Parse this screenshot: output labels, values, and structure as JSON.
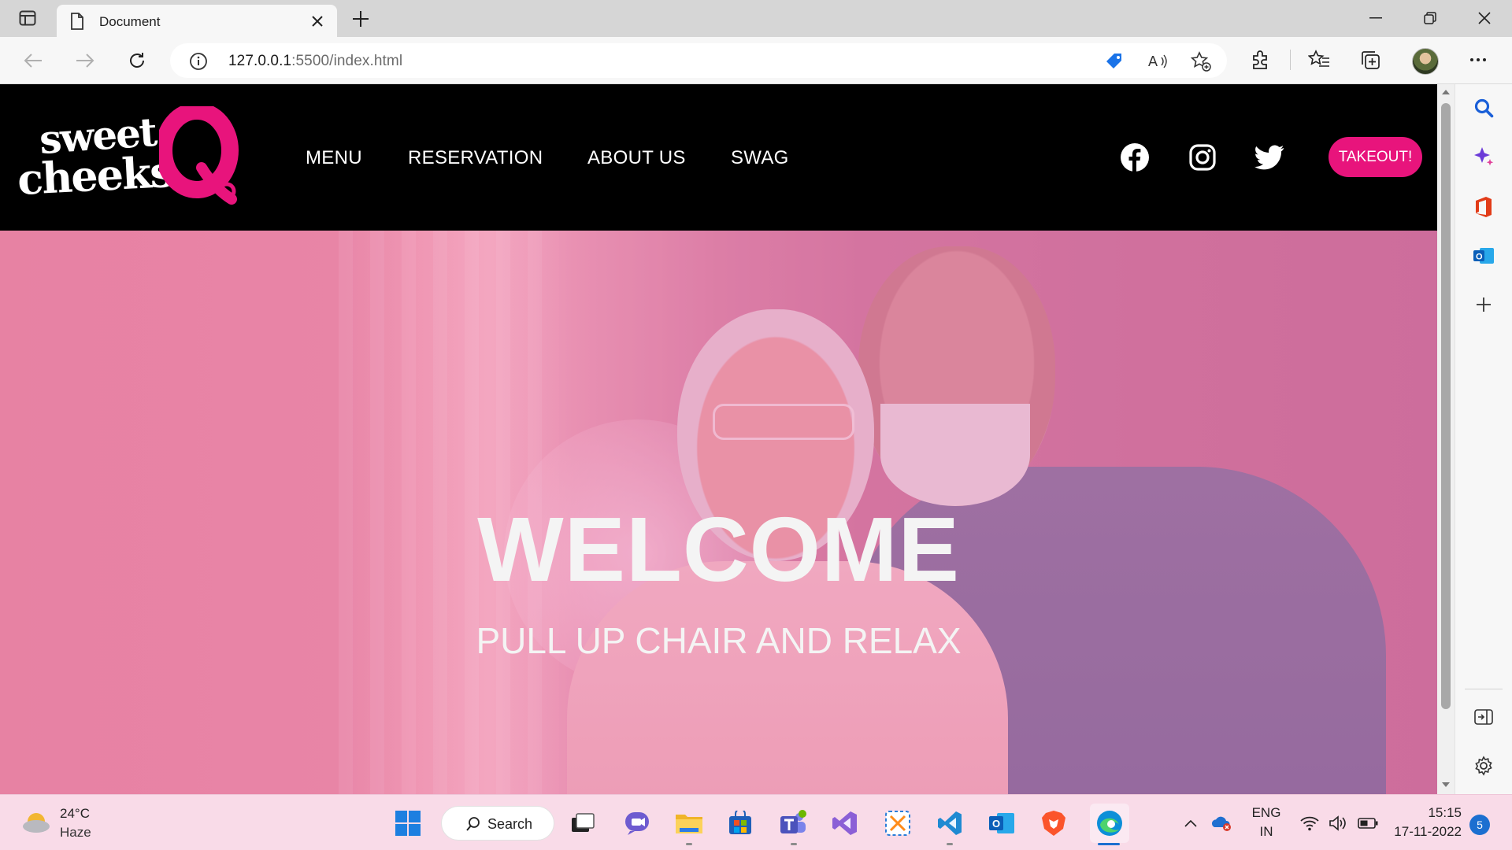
{
  "browser": {
    "tab_title": "Document",
    "url_host": "127.0.0.1",
    "url_rest": ":5500/index.html"
  },
  "site": {
    "logo_line1": "sweet",
    "logo_line2": "cheeks",
    "nav": [
      "MENU",
      "RESERVATION",
      "ABOUT US",
      "SWAG"
    ],
    "social_icons": [
      "facebook-icon",
      "instagram-icon",
      "twitter-icon"
    ],
    "takeout_label": "TAKEOUT!",
    "hero_title": "WELCOME",
    "hero_subtitle": "PULL UP CHAIR AND RELAX",
    "accent_color": "#e8147c"
  },
  "taskbar": {
    "weather_temp": "24°C",
    "weather_condition": "Haze",
    "search_label": "Search",
    "language_line1": "ENG",
    "language_line2": "IN",
    "time": "15:15",
    "date": "17-11-2022",
    "notification_count": "5"
  }
}
